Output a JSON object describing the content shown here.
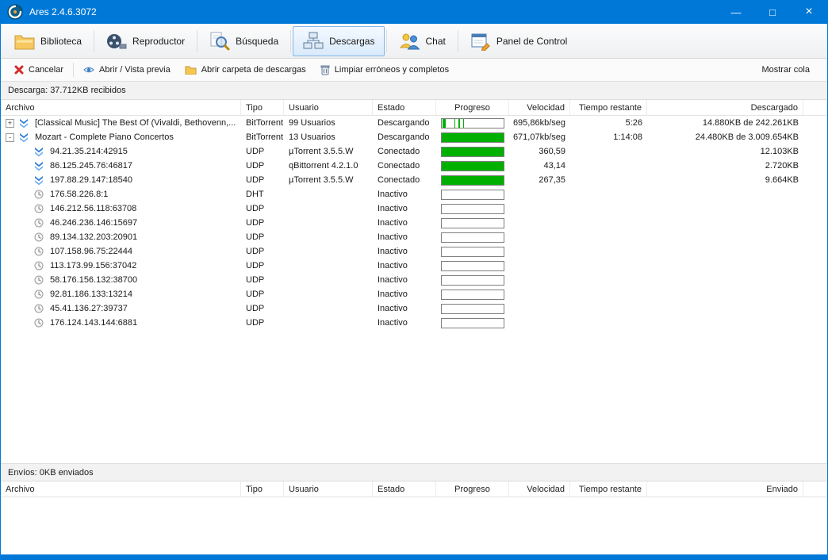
{
  "window": {
    "title": "Ares 2.4.6.3072",
    "controls": {
      "minimize": "—",
      "maximize": "□",
      "close": "×"
    }
  },
  "colors": {
    "accent": "#0078d7",
    "progress_green": "#00b000",
    "selected_tab_border": "#84b6e8"
  },
  "tabs": {
    "items": [
      {
        "label": "Biblioteca",
        "icon": "library-icon",
        "active": false
      },
      {
        "label": "Reproductor",
        "icon": "player-icon",
        "active": false
      },
      {
        "label": "Búsqueda",
        "icon": "search-icon",
        "active": false
      },
      {
        "label": "Descargas",
        "icon": "downloads-icon",
        "active": true
      },
      {
        "label": "Chat",
        "icon": "chat-icon",
        "active": false
      },
      {
        "label": "Panel de Control",
        "icon": "control-panel-icon",
        "active": false
      }
    ]
  },
  "action_bar": {
    "buttons": [
      {
        "label": "Cancelar",
        "icon": "cancel-icon"
      },
      {
        "label": "Abrir / Vista previa",
        "icon": "preview-icon"
      },
      {
        "label": "Abrir carpeta de descargas",
        "icon": "folder-icon"
      },
      {
        "label": "Limpiar erróneos y completos",
        "icon": "trash-icon"
      }
    ],
    "right_link": "Mostrar cola"
  },
  "downloads_panel": {
    "summary": "Descarga: 37.712KB recibidos",
    "columns": [
      "Archivo",
      "Tipo",
      "Usuario",
      "Estado",
      "Progreso",
      "Velocidad",
      "Tiempo restante",
      "Descargado"
    ],
    "rows": [
      {
        "level": 0,
        "expand": "+",
        "icon": "arrows",
        "name": "[Classical Music] The Best Of (Vivaldi, Bethovenn,...",
        "type": "BitTorrent",
        "user": "99 Usuarios",
        "state": "Descargando",
        "progress": 0,
        "pieces": [
          [
            1,
            6
          ],
          [
            20,
            2
          ],
          [
            27,
            2
          ],
          [
            34,
            2
          ]
        ],
        "speed": "695,86kb/seg",
        "eta": "5:26",
        "downloaded": "14.880KB de 242.261KB"
      },
      {
        "level": 0,
        "expand": "-",
        "icon": "arrows",
        "name": "Mozart - Complete Piano Concertos",
        "type": "BitTorrent",
        "user": "13 Usuarios",
        "state": "Descargando",
        "progress": 100,
        "speed": "671,07kb/seg",
        "eta": "1:14:08",
        "downloaded": "24.480KB de 3.009.654KB"
      },
      {
        "level": 1,
        "expand": "",
        "icon": "arrows",
        "name": "94.21.35.214:42915",
        "type": "UDP",
        "user": "µTorrent 3.5.5.W",
        "state": "Conectado",
        "progress": 100,
        "speed": "360,59",
        "eta": "",
        "downloaded": "12.103KB"
      },
      {
        "level": 1,
        "expand": "",
        "icon": "arrows",
        "name": "86.125.245.76:46817",
        "type": "UDP",
        "user": "qBittorrent 4.2.1.0",
        "state": "Conectado",
        "progress": 100,
        "speed": "43,14",
        "eta": "",
        "downloaded": "2.720KB"
      },
      {
        "level": 1,
        "expand": "",
        "icon": "arrows",
        "name": "197.88.29.147:18540",
        "type": "UDP",
        "user": "µTorrent 3.5.5.W",
        "state": "Conectado",
        "progress": 100,
        "speed": "267,35",
        "eta": "",
        "downloaded": "9.664KB"
      },
      {
        "level": 1,
        "expand": "",
        "icon": "clock",
        "name": "176.58.226.8:1",
        "type": "DHT",
        "user": "",
        "state": "Inactivo",
        "progress": 0,
        "speed": "",
        "eta": "",
        "downloaded": ""
      },
      {
        "level": 1,
        "expand": "",
        "icon": "clock",
        "name": "146.212.56.118:63708",
        "type": "UDP",
        "user": "",
        "state": "Inactivo",
        "progress": 0,
        "speed": "",
        "eta": "",
        "downloaded": ""
      },
      {
        "level": 1,
        "expand": "",
        "icon": "clock",
        "name": "46.246.236.146:15697",
        "type": "UDP",
        "user": "",
        "state": "Inactivo",
        "progress": 0,
        "speed": "",
        "eta": "",
        "downloaded": ""
      },
      {
        "level": 1,
        "expand": "",
        "icon": "clock",
        "name": "89.134.132.203:20901",
        "type": "UDP",
        "user": "",
        "state": "Inactivo",
        "progress": 0,
        "speed": "",
        "eta": "",
        "downloaded": ""
      },
      {
        "level": 1,
        "expand": "",
        "icon": "clock",
        "name": "107.158.96.75:22444",
        "type": "UDP",
        "user": "",
        "state": "Inactivo",
        "progress": 0,
        "speed": "",
        "eta": "",
        "downloaded": ""
      },
      {
        "level": 1,
        "expand": "",
        "icon": "clock",
        "name": "113.173.99.156:37042",
        "type": "UDP",
        "user": "",
        "state": "Inactivo",
        "progress": 0,
        "speed": "",
        "eta": "",
        "downloaded": ""
      },
      {
        "level": 1,
        "expand": "",
        "icon": "clock",
        "name": "58.176.156.132:38700",
        "type": "UDP",
        "user": "",
        "state": "Inactivo",
        "progress": 0,
        "speed": "",
        "eta": "",
        "downloaded": ""
      },
      {
        "level": 1,
        "expand": "",
        "icon": "clock",
        "name": "92.81.186.133:13214",
        "type": "UDP",
        "user": "",
        "state": "Inactivo",
        "progress": 0,
        "speed": "",
        "eta": "",
        "downloaded": ""
      },
      {
        "level": 1,
        "expand": "",
        "icon": "clock",
        "name": "45.41.136.27:39737",
        "type": "UDP",
        "user": "",
        "state": "Inactivo",
        "progress": 0,
        "speed": "",
        "eta": "",
        "downloaded": ""
      },
      {
        "level": 1,
        "expand": "",
        "icon": "clock",
        "name": "176.124.143.144:6881",
        "type": "UDP",
        "user": "",
        "state": "Inactivo",
        "progress": 0,
        "speed": "",
        "eta": "",
        "downloaded": ""
      }
    ]
  },
  "uploads_panel": {
    "summary": "Envíos: 0KB enviados",
    "columns": [
      "Archivo",
      "Tipo",
      "Usuario",
      "Estado",
      "Progreso",
      "Velocidad",
      "Tiempo restante",
      "Enviado"
    ],
    "rows": []
  }
}
